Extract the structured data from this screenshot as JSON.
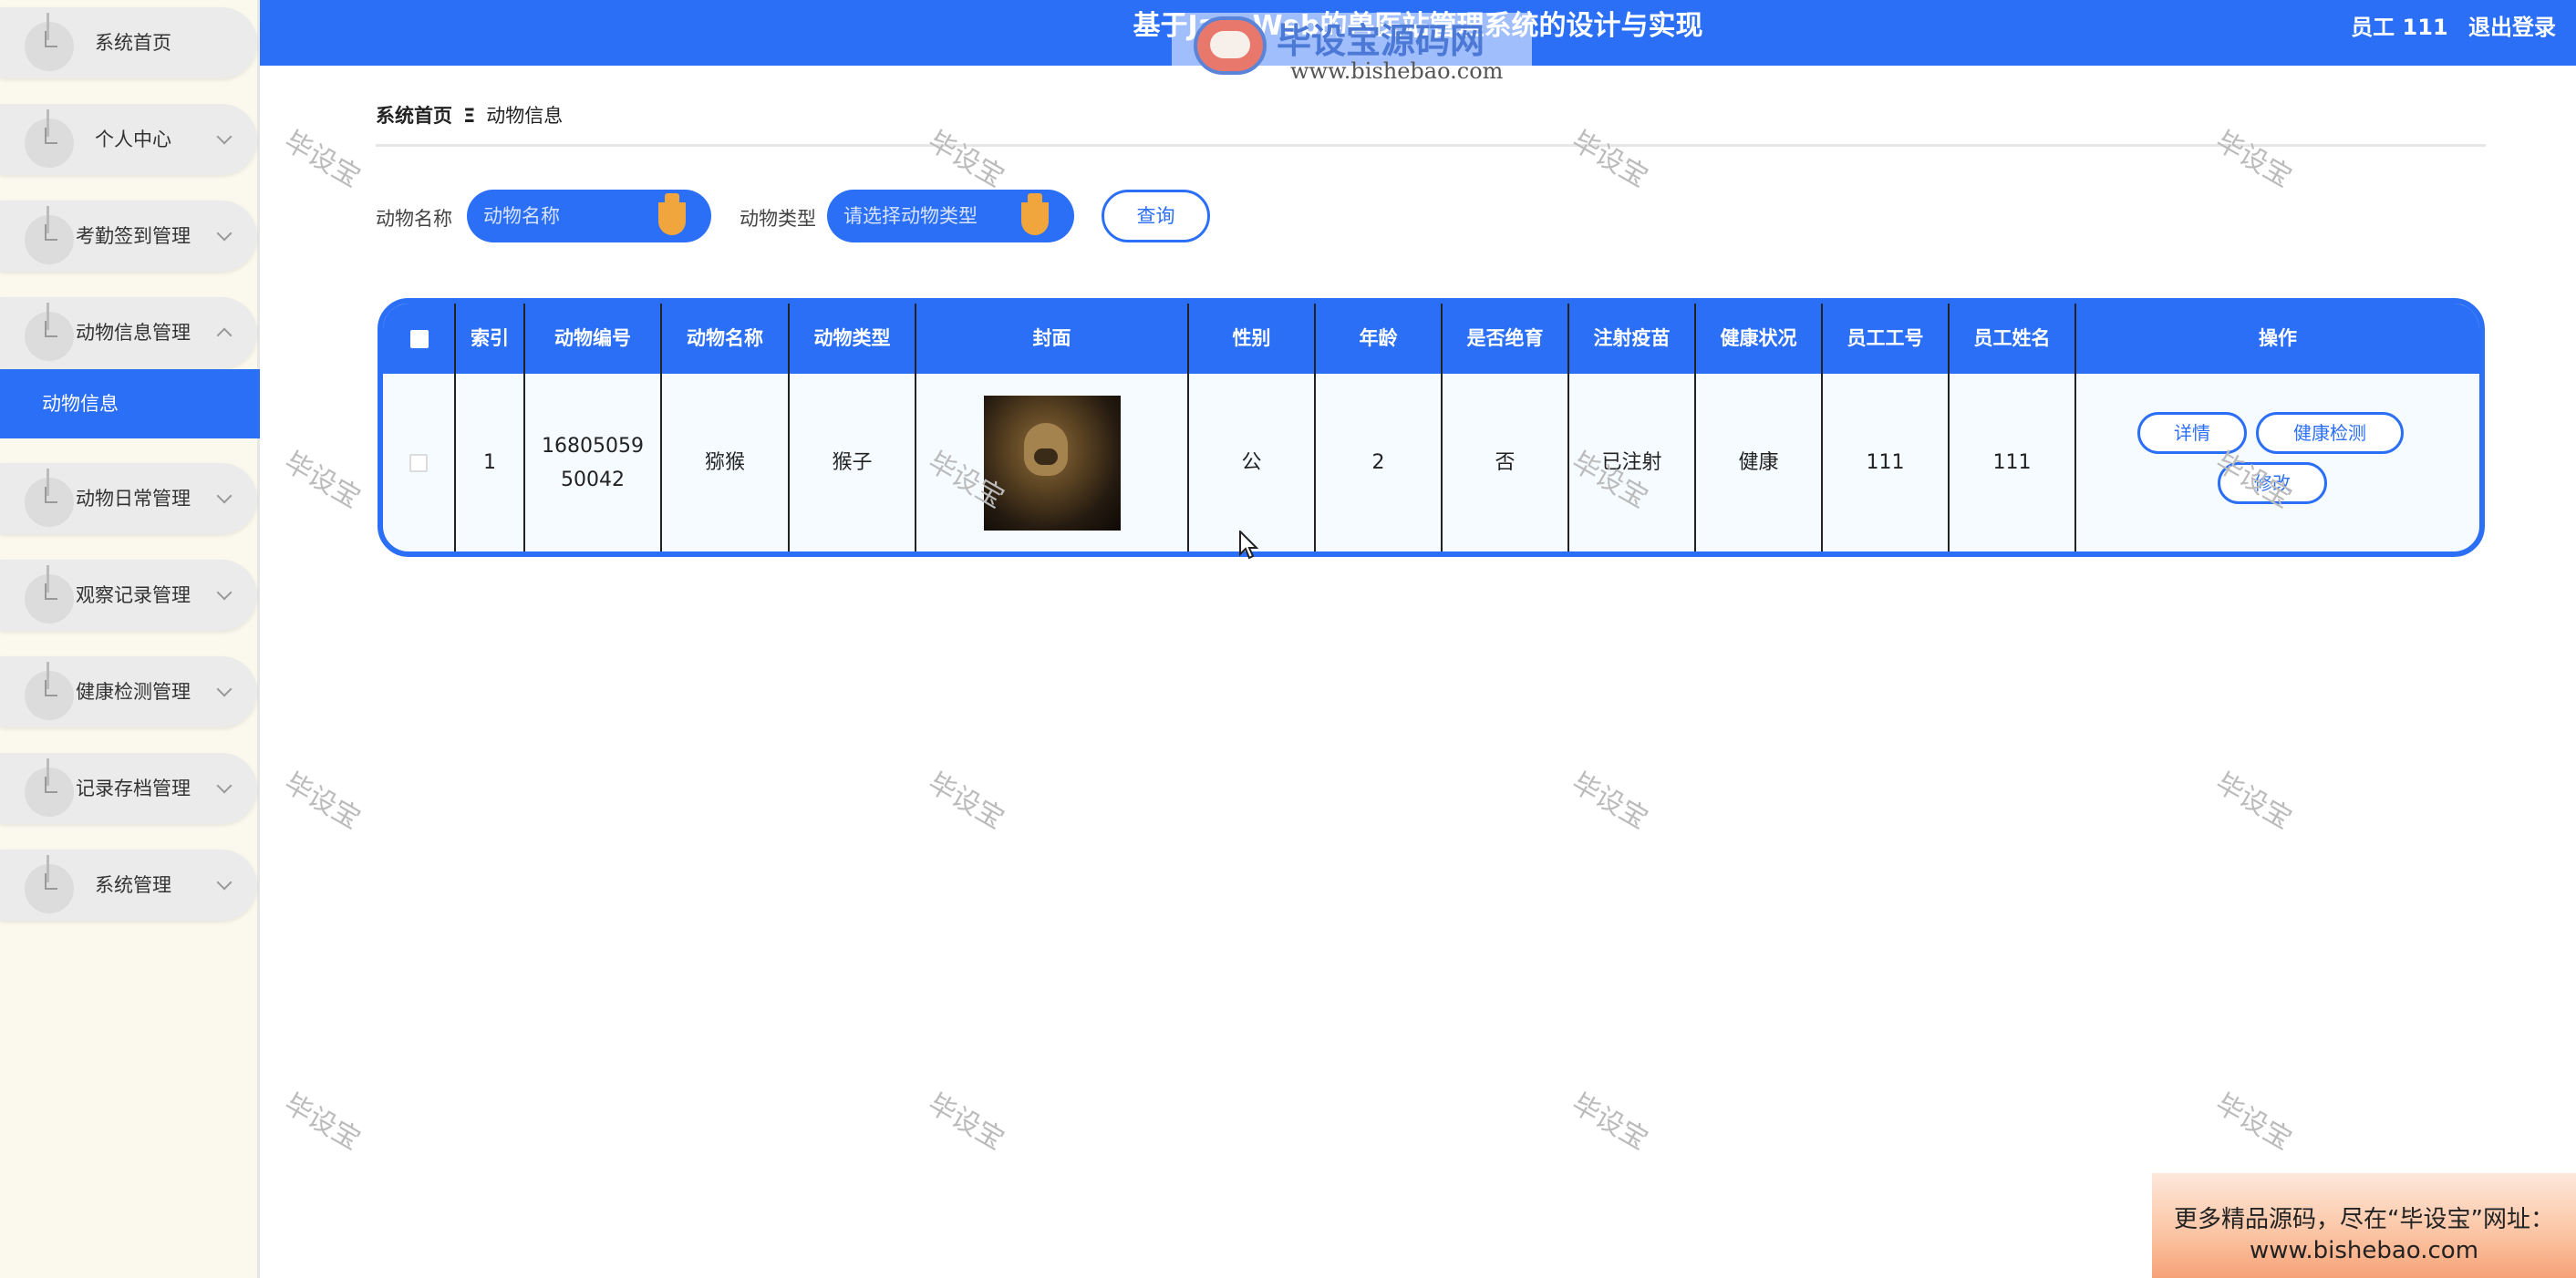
{
  "header": {
    "title": "基于JavaWeb的兽医站管理系统的设计与实现",
    "user_label": "员工 111",
    "logout_label": "退出登录"
  },
  "logo": {
    "name": "毕设宝源码网",
    "url": "www.bishebao.com"
  },
  "sidebar": {
    "items": [
      {
        "label": "系统首页",
        "expandable": false
      },
      {
        "label": "个人中心",
        "expandable": true
      },
      {
        "label": "考勤签到管理",
        "expandable": true
      },
      {
        "label": "动物信息管理",
        "expandable": true,
        "expanded": true
      },
      {
        "label": "动物日常管理",
        "expandable": true
      },
      {
        "label": "观察记录管理",
        "expandable": true
      },
      {
        "label": "健康检测管理",
        "expandable": true
      },
      {
        "label": "记录存档管理",
        "expandable": true
      },
      {
        "label": "系统管理",
        "expandable": true
      }
    ],
    "active_sub_item": "动物信息"
  },
  "breadcrumb": {
    "home": "系统首页",
    "separator": "Ξ",
    "current": "动物信息"
  },
  "search": {
    "name_label": "动物名称",
    "name_placeholder": "动物名称",
    "type_label": "动物类型",
    "type_placeholder": "请选择动物类型",
    "query_button": "查询"
  },
  "table": {
    "columns": [
      "索引",
      "动物编号",
      "动物名称",
      "动物类型",
      "封面",
      "性别",
      "年龄",
      "是否绝育",
      "注射疫苗",
      "健康状况",
      "员工工号",
      "员工姓名",
      "操作"
    ],
    "rows": [
      {
        "index": "1",
        "animal_no": "1680505950042",
        "animal_name": "猕猴",
        "animal_type": "猴子",
        "gender": "公",
        "age": "2",
        "sterilized": "否",
        "vaccinated": "已注射",
        "health": "健康",
        "staff_no": "111",
        "staff_name": "111"
      }
    ],
    "actions": [
      "详情",
      "健康检测",
      "修改"
    ]
  },
  "watermark_text": "毕设宝",
  "ad": {
    "line1": "更多精品源码，尽在“毕设宝”网址：",
    "line2": "www.bishebao.com"
  }
}
